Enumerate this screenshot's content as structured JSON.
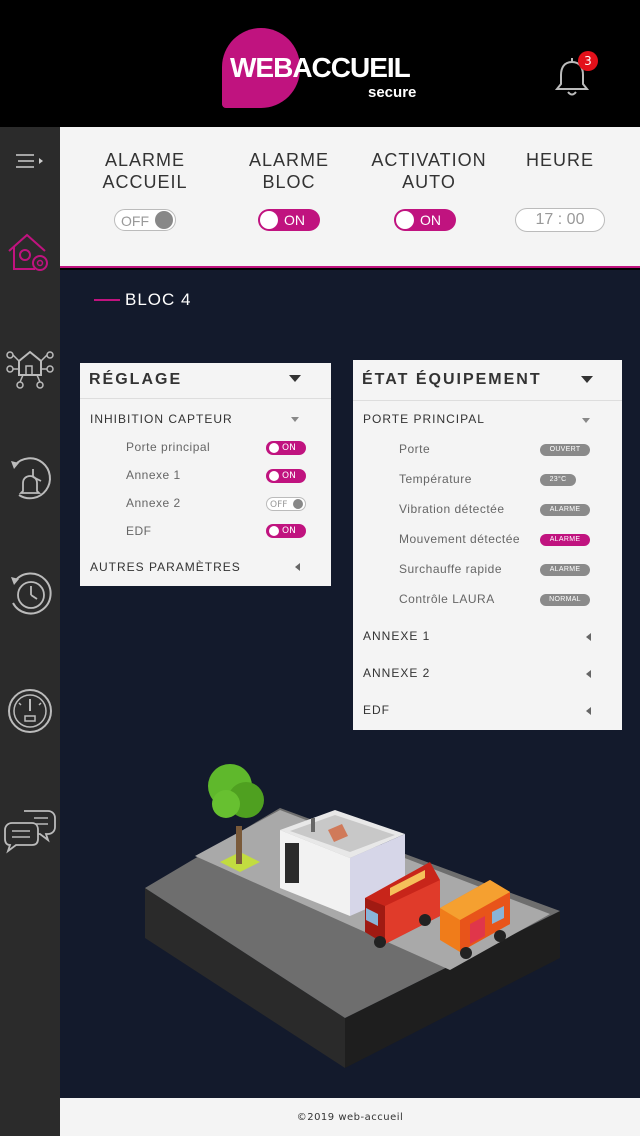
{
  "header": {
    "logo_main": "WEBACCUEIL",
    "logo_sub": "secure",
    "notifications_count": "3"
  },
  "sidebar": {
    "items": [
      "menu-toggle",
      "home-settings",
      "network-home",
      "alarm-history",
      "clock-history",
      "gauge",
      "chat"
    ]
  },
  "controls": {
    "alarme_accueil": {
      "label_1": "ALARME",
      "label_2": "ACCUEIL",
      "state": "OFF"
    },
    "alarme_bloc": {
      "label_1": "ALARME",
      "label_2": "BLOC",
      "state": "ON"
    },
    "activation_auto": {
      "label_1": "ACTIVATION",
      "label_2": "AUTO",
      "state": "ON"
    },
    "heure": {
      "label": "HEURE",
      "value": "17 : 00"
    }
  },
  "bloc": {
    "title": "BLOC 4"
  },
  "reglage": {
    "title": "RÉGLAGE",
    "section1": "INHIBITION CAPTEUR",
    "rows": [
      {
        "label": "Porte principal",
        "state": "ON"
      },
      {
        "label": "Annexe 1",
        "state": "ON"
      },
      {
        "label": "Annexe 2",
        "state": "OFF"
      },
      {
        "label": "EDF",
        "state": "ON"
      }
    ],
    "section2": "AUTRES PARAMÈTRES"
  },
  "etat": {
    "title": "ÉTAT ÉQUIPEMENT",
    "section1": "PORTE PRINCIPAL",
    "rows": [
      {
        "label": "Porte",
        "status": "OUVERT",
        "color": "#8a8a8a"
      },
      {
        "label": "Température",
        "status": "23°C",
        "color": "#8a8a8a"
      },
      {
        "label": "Vibration détectée",
        "status": "ALARME",
        "color": "#8a8a8a"
      },
      {
        "label": "Mouvement détectée",
        "status": "ALARME",
        "color": "#c0137f"
      },
      {
        "label": "Surchauffe rapide",
        "status": "ALARME",
        "color": "#8a8a8a"
      },
      {
        "label": "Contrôle LAURA",
        "status": "NORMAL",
        "color": "#8a8a8a"
      }
    ],
    "sections": [
      "ANNEXE 1",
      "ANNEXE 2",
      "EDF"
    ]
  },
  "footer": {
    "text": "©2019 web-accueil"
  },
  "colors": {
    "accent": "#c0137f",
    "dark_bg": "#131a2c",
    "sidebar": "#2b2b2b"
  }
}
